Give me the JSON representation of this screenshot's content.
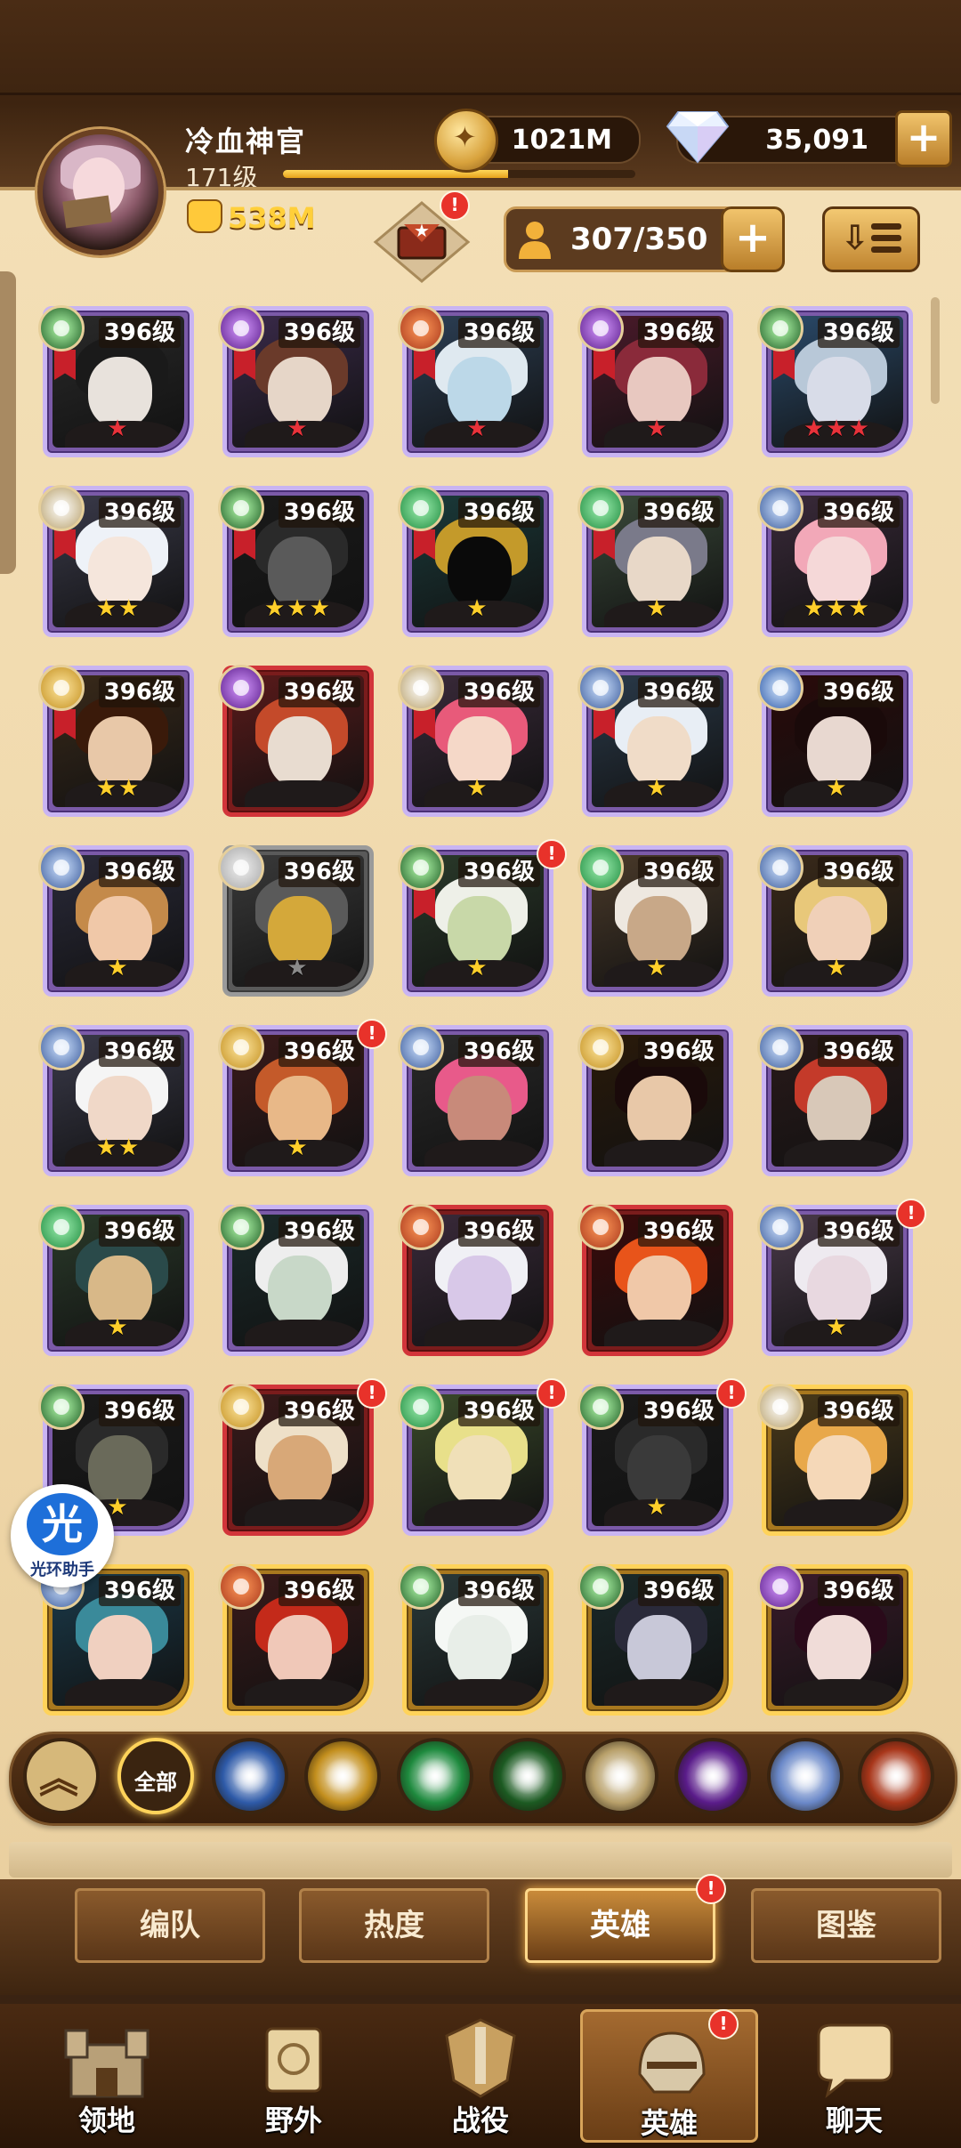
{
  "player": {
    "name": "冷血神官",
    "level": "171级",
    "xp_fraction": 0.64,
    "power": "538M"
  },
  "resources": {
    "gold": "1021M",
    "diamonds": "35,091",
    "roster": "307/350"
  },
  "colors": {
    "accent_gold": "#ffd35a",
    "badge_red": "#e8322a",
    "parchment": "#f0d8aa"
  },
  "heroes": [
    {
      "level": "396级",
      "stars": "★",
      "border": "purple",
      "faction": "grave",
      "badge": false,
      "ribbon": true,
      "palette": [
        "#2a2a2a",
        "#e8e2dc",
        "#1a1a1a"
      ]
    },
    {
      "level": "396级",
      "stars": "★",
      "border": "purple",
      "faction": "dark",
      "badge": false,
      "ribbon": true,
      "palette": [
        "#3a2a4a",
        "#e6d6c8",
        "#6a3a2a"
      ]
    },
    {
      "level": "396级",
      "stars": "★",
      "border": "purple",
      "faction": "maul",
      "badge": false,
      "ribbon": true,
      "palette": [
        "#2c3f55",
        "#bcd8e8",
        "#dfe9f0"
      ]
    },
    {
      "level": "396级",
      "stars": "★",
      "border": "purple",
      "faction": "dark",
      "badge": false,
      "ribbon": true,
      "palette": [
        "#4a1a2a",
        "#e8c8c0",
        "#8a2a3a"
      ]
    },
    {
      "level": "396级",
      "stars": "★★★",
      "border": "purple",
      "faction": "grave",
      "badge": false,
      "ribbon": true,
      "palette": [
        "#2a4a6a",
        "#d8dce8",
        "#b8c8d8"
      ]
    },
    {
      "level": "396级",
      "stars": "★★",
      "border": "purple",
      "faction": "celest",
      "badge": false,
      "ribbon": true,
      "palette": [
        "#3a3a4a",
        "#f5e6dc",
        "#eef2f8"
      ]
    },
    {
      "level": "396级",
      "stars": "★★★",
      "border": "purple",
      "faction": "grave",
      "badge": false,
      "ribbon": true,
      "palette": [
        "#1a1a1a",
        "#5a5a5a",
        "#2a2a2a"
      ]
    },
    {
      "level": "396级",
      "stars": "★",
      "border": "purple",
      "faction": "wild",
      "badge": false,
      "ribbon": true,
      "palette": [
        "#1a3a3a",
        "#0a0a0a",
        "#c49a2a"
      ]
    },
    {
      "level": "396级",
      "stars": "★",
      "border": "purple",
      "faction": "wild",
      "badge": false,
      "ribbon": true,
      "palette": [
        "#3a4a3a",
        "#e8d8c8",
        "#7a7a8a"
      ]
    },
    {
      "level": "396级",
      "stars": "★★★",
      "border": "purple",
      "faction": "hypo",
      "badge": false,
      "ribbon": false,
      "palette": [
        "#3a2a3a",
        "#f5d8d8",
        "#f2a8b8"
      ]
    },
    {
      "level": "396级",
      "stars": "★★",
      "border": "purple",
      "faction": "light",
      "badge": false,
      "ribbon": true,
      "palette": [
        "#3a2a1a",
        "#e8c8a8",
        "#3a1a0a"
      ]
    },
    {
      "level": "396级",
      "stars": "",
      "border": "red",
      "faction": "dark",
      "badge": false,
      "ribbon": false,
      "palette": [
        "#5a1a1a",
        "#e8dcd0",
        "#c44a2a"
      ]
    },
    {
      "level": "396级",
      "stars": "★",
      "border": "purple",
      "faction": "celest",
      "badge": false,
      "ribbon": true,
      "palette": [
        "#3a2a3a",
        "#f5d8c8",
        "#e85a7a"
      ]
    },
    {
      "level": "396级",
      "stars": "★",
      "border": "purple",
      "faction": "hypo",
      "badge": false,
      "ribbon": true,
      "palette": [
        "#2a3a4a",
        "#f0dcc8",
        "#e8eef5"
      ]
    },
    {
      "level": "396级",
      "stars": "★",
      "border": "purple",
      "faction": "light2",
      "badge": false,
      "ribbon": false,
      "palette": [
        "#2a0a0a",
        "#e8d8d0",
        "#1a0a0a"
      ]
    },
    {
      "level": "396级",
      "stars": "★",
      "border": "purple",
      "faction": "hypo",
      "badge": false,
      "ribbon": false,
      "palette": [
        "#2a2a3a",
        "#f0c8a8",
        "#c48a4a"
      ]
    },
    {
      "level": "396级",
      "stars": "★",
      "border": "grey",
      "faction": "none",
      "badge": false,
      "ribbon": false,
      "palette": [
        "#3a3a3a",
        "#d4a83a",
        "#5a5a5a"
      ]
    },
    {
      "level": "396级",
      "stars": "★",
      "border": "purple",
      "faction": "grave",
      "badge": true,
      "ribbon": true,
      "palette": [
        "#2a3a2a",
        "#c8d8a8",
        "#eef0e8"
      ]
    },
    {
      "level": "396级",
      "stars": "★",
      "border": "purple",
      "faction": "wild",
      "badge": false,
      "ribbon": false,
      "palette": [
        "#4a3a2a",
        "#c8a888",
        "#eee8e0"
      ]
    },
    {
      "level": "396级",
      "stars": "★",
      "border": "purple",
      "faction": "hypo",
      "badge": false,
      "ribbon": false,
      "palette": [
        "#3a2a1a",
        "#f0d0b8",
        "#e8c87a"
      ]
    },
    {
      "level": "396级",
      "stars": "★★",
      "border": "purple",
      "faction": "hypo",
      "badge": false,
      "ribbon": false,
      "palette": [
        "#3a3a4a",
        "#f0d8c8",
        "#f5f5f5"
      ]
    },
    {
      "level": "396级",
      "stars": "★",
      "border": "purple",
      "faction": "light",
      "badge": true,
      "ribbon": false,
      "palette": [
        "#3a1a1a",
        "#e8b888",
        "#c45a2a"
      ]
    },
    {
      "level": "396级",
      "stars": "",
      "border": "purple",
      "faction": "hypo",
      "badge": false,
      "ribbon": false,
      "palette": [
        "#2a2a2a",
        "#c88a7a",
        "#e85a8a"
      ]
    },
    {
      "level": "396级",
      "stars": "",
      "border": "purple",
      "faction": "light",
      "badge": false,
      "ribbon": false,
      "palette": [
        "#2a1a0a",
        "#e8c8a8",
        "#1a0a0a"
      ]
    },
    {
      "level": "396级",
      "stars": "",
      "border": "purple",
      "faction": "hypo",
      "badge": false,
      "ribbon": false,
      "palette": [
        "#2a1a1a",
        "#d8c8b8",
        "#c43a2a"
      ]
    },
    {
      "level": "396级",
      "stars": "★",
      "border": "purple",
      "faction": "wild",
      "badge": false,
      "ribbon": false,
      "palette": [
        "#2a3a2a",
        "#d8b888",
        "#2a4a4a"
      ]
    },
    {
      "level": "396级",
      "stars": "",
      "border": "purple",
      "faction": "grave",
      "badge": false,
      "ribbon": false,
      "palette": [
        "#1a2a2a",
        "#c8d8c8",
        "#eeeeee"
      ]
    },
    {
      "level": "396级",
      "stars": "",
      "border": "red",
      "faction": "maul",
      "badge": false,
      "ribbon": false,
      "palette": [
        "#3a2a3a",
        "#d8c8e8",
        "#f0f0f5"
      ]
    },
    {
      "level": "396级",
      "stars": "",
      "border": "red",
      "faction": "maul",
      "badge": false,
      "ribbon": false,
      "palette": [
        "#3a0a0a",
        "#f0c8a8",
        "#e8541a"
      ]
    },
    {
      "level": "396级",
      "stars": "★",
      "border": "purple",
      "faction": "hypo",
      "badge": true,
      "ribbon": false,
      "palette": [
        "#4a3a4a",
        "#e8d8e0",
        "#eeeaf0"
      ]
    },
    {
      "level": "396级",
      "stars": "★",
      "border": "purple",
      "faction": "grave",
      "badge": false,
      "ribbon": false,
      "palette": [
        "#1a1a1a",
        "#6a6a5a",
        "#2a2a2a"
      ]
    },
    {
      "level": "396级",
      "stars": "",
      "border": "red",
      "faction": "light",
      "badge": true,
      "ribbon": false,
      "palette": [
        "#3a1a1a",
        "#d8a878",
        "#eee0c8"
      ]
    },
    {
      "level": "396级",
      "stars": "",
      "border": "purple",
      "faction": "wild",
      "badge": true,
      "ribbon": false,
      "palette": [
        "#3a4a2a",
        "#f0e0b8",
        "#e8e08a"
      ]
    },
    {
      "level": "396级",
      "stars": "★",
      "border": "purple",
      "faction": "grave",
      "badge": true,
      "ribbon": false,
      "palette": [
        "#1a1a1a",
        "#3a3a3a",
        "#2a2a2a"
      ]
    },
    {
      "level": "396级",
      "stars": "",
      "border": "gold",
      "faction": "celest",
      "badge": false,
      "ribbon": false,
      "palette": [
        "#4a3a1a",
        "#f5d8b8",
        "#e8a84a"
      ]
    },
    {
      "level": "396级",
      "stars": "",
      "border": "gold",
      "faction": "hypo",
      "badge": false,
      "ribbon": false,
      "palette": [
        "#1a3a4a",
        "#f0d0c0",
        "#3a8a9a"
      ]
    },
    {
      "level": "396级",
      "stars": "",
      "border": "gold",
      "faction": "maul",
      "badge": false,
      "ribbon": false,
      "palette": [
        "#3a1a1a",
        "#f0c8b8",
        "#c42a1a"
      ]
    },
    {
      "level": "396级",
      "stars": "",
      "border": "gold",
      "faction": "grave",
      "badge": false,
      "ribbon": false,
      "palette": [
        "#2a3a3a",
        "#e8eee8",
        "#f5f8f5"
      ]
    },
    {
      "level": "396级",
      "stars": "",
      "border": "gold",
      "faction": "grave",
      "badge": false,
      "ribbon": false,
      "palette": [
        "#1a2a2a",
        "#c8c8d8",
        "#2a2a3a"
      ]
    },
    {
      "level": "396级",
      "stars": "",
      "border": "gold",
      "faction": "dark",
      "badge": false,
      "ribbon": false,
      "palette": [
        "#3a1a2a",
        "#f0dcd8",
        "#2a0a1a"
      ]
    }
  ],
  "faction_filters": [
    {
      "name": "up",
      "icon": "up-arrows-icon"
    },
    {
      "name": "all",
      "label": "全部"
    },
    {
      "name": "lightbearer",
      "icon": "lightbearer-icon"
    },
    {
      "name": "light",
      "icon": "light-faction-icon"
    },
    {
      "name": "wilder",
      "icon": "wilder-icon"
    },
    {
      "name": "graveborn",
      "icon": "graveborn-icon"
    },
    {
      "name": "celestial",
      "icon": "celestial-icon"
    },
    {
      "name": "hypogean",
      "icon": "hypogean-icon"
    },
    {
      "name": "dimensional",
      "icon": "dimensional-icon"
    },
    {
      "name": "mauler",
      "icon": "mauler-icon"
    }
  ],
  "helper": {
    "glyph": "光",
    "label": "光环助手"
  },
  "subtabs": [
    "编队",
    "热度",
    "英雄",
    "图鉴"
  ],
  "bottom_nav": [
    "领地",
    "野外",
    "战役",
    "英雄",
    "聊天"
  ],
  "badge_mark": "!"
}
